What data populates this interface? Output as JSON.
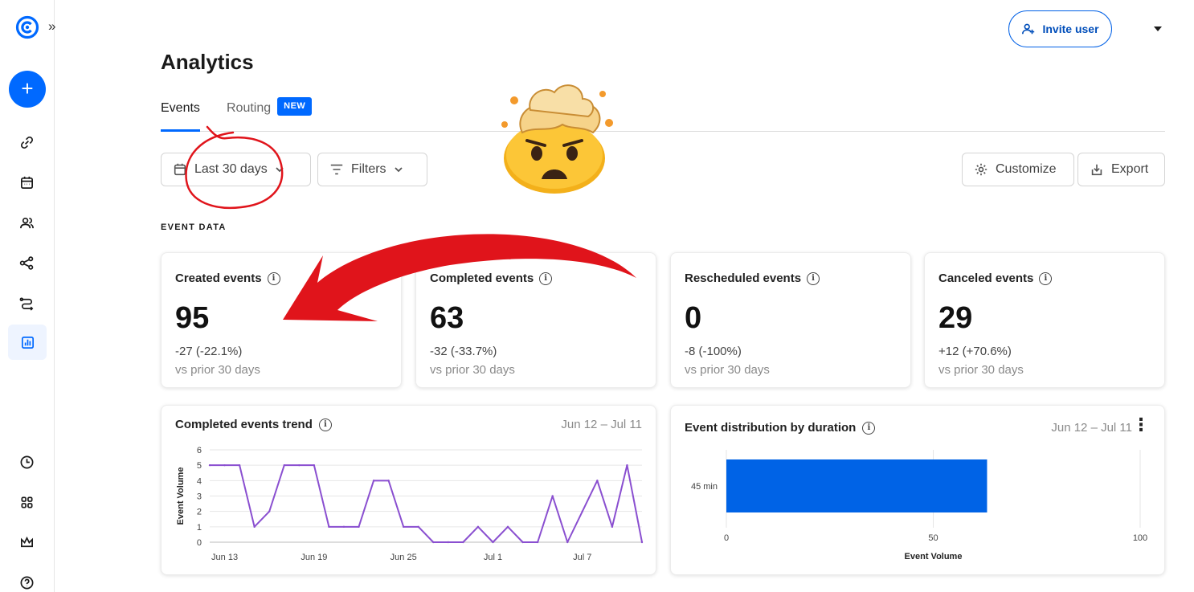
{
  "app": {
    "title": "Analytics",
    "invite_label": "Invite user"
  },
  "tabs": [
    {
      "label": "Events"
    },
    {
      "label": "Routing",
      "badge": "NEW"
    }
  ],
  "controls": {
    "date_range": "Last 30 days",
    "filters": "Filters",
    "customize": "Customize",
    "export": "Export"
  },
  "section_label": "EVENT DATA",
  "stats": [
    {
      "title": "Created events",
      "value": "95",
      "change": "-27 (-22.1%)",
      "sub": "vs prior 30 days"
    },
    {
      "title": "Completed events",
      "value": "63",
      "change": "-32 (-33.7%)",
      "sub": "vs prior 30 days"
    },
    {
      "title": "Rescheduled events",
      "value": "0",
      "change": "-8 (-100%)",
      "sub": "vs prior 30 days"
    },
    {
      "title": "Canceled events",
      "value": "29",
      "change": "+12 (+70.6%)",
      "sub": "vs prior 30 days"
    }
  ],
  "trend_card": {
    "title": "Completed events trend",
    "range": "Jun 12 – Jul 11"
  },
  "duration_card": {
    "title": "Event distribution by duration",
    "range": "Jun 12 – Jul 11"
  },
  "colors": {
    "accent": "#0069ff",
    "line": "#8a4fd0",
    "bar": "#0063e6",
    "annotation": "#e0141b"
  },
  "chart_data": [
    {
      "type": "line",
      "ylabel": "Event Volume",
      "ylim": [
        0,
        6
      ],
      "yticks": [
        0,
        1,
        2,
        3,
        4,
        5,
        6
      ],
      "xticks": [
        "Jun 13",
        "Jun 19",
        "Jun 25",
        "Jul 1",
        "Jul 7"
      ],
      "x": [
        "Jun 12",
        "Jun 13",
        "Jun 14",
        "Jun 15",
        "Jun 16",
        "Jun 17",
        "Jun 18",
        "Jun 19",
        "Jun 20",
        "Jun 21",
        "Jun 22",
        "Jun 23",
        "Jun 24",
        "Jun 25",
        "Jun 26",
        "Jun 27",
        "Jun 28",
        "Jun 29",
        "Jun 30",
        "Jul 1",
        "Jul 2",
        "Jul 3",
        "Jul 4",
        "Jul 5",
        "Jul 6",
        "Jul 7",
        "Jul 8",
        "Jul 9",
        "Jul 10",
        "Jul 11"
      ],
      "values": [
        5,
        5,
        5,
        1,
        2,
        5,
        5,
        5,
        1,
        1,
        1,
        4,
        4,
        1,
        1,
        0,
        0,
        0,
        1,
        0,
        1,
        0,
        0,
        3,
        0,
        2,
        4,
        1,
        5,
        0
      ],
      "grid": true
    },
    {
      "type": "bar",
      "orientation": "horizontal",
      "categories": [
        "45 min"
      ],
      "values": [
        63
      ],
      "xlabel": "Event Volume",
      "xlim": [
        0,
        100
      ],
      "xticks": [
        0,
        50,
        100
      ]
    }
  ]
}
